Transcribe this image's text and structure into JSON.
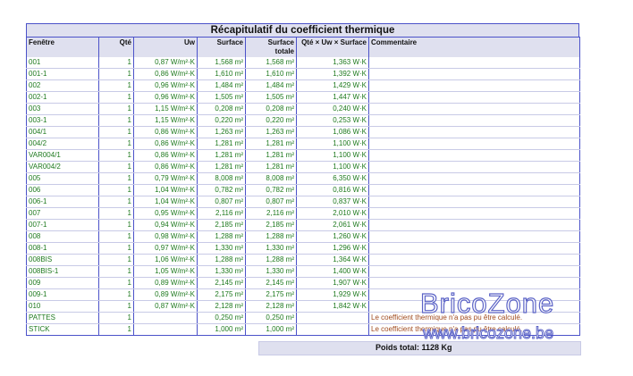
{
  "title": "Récapitulatif du coefficient thermique",
  "columns": [
    "Fenêtre",
    "Qté",
    "Uw",
    "Surface",
    "Surface totale",
    "Qté × Uw × Surface",
    "Commentaire"
  ],
  "rows": [
    [
      "001",
      "1",
      "0,87 W/m²·K",
      "1,568 m²",
      "1,568 m²",
      "1,363 W·K",
      ""
    ],
    [
      "001-1",
      "1",
      "0,86 W/m²·K",
      "1,610 m²",
      "1,610 m²",
      "1,392 W·K",
      ""
    ],
    [
      "002",
      "1",
      "0,96 W/m²·K",
      "1,484 m²",
      "1,484 m²",
      "1,429 W·K",
      ""
    ],
    [
      "002-1",
      "1",
      "0,96 W/m²·K",
      "1,505 m²",
      "1,505 m²",
      "1,447 W·K",
      ""
    ],
    [
      "003",
      "1",
      "1,15 W/m²·K",
      "0,208 m²",
      "0,208 m²",
      "0,240 W·K",
      ""
    ],
    [
      "003-1",
      "1",
      "1,15 W/m²·K",
      "0,220 m²",
      "0,220 m²",
      "0,253 W·K",
      ""
    ],
    [
      "004/1",
      "1",
      "0,86 W/m²·K",
      "1,263 m²",
      "1,263 m²",
      "1,086 W·K",
      ""
    ],
    [
      "004/2",
      "1",
      "0,86 W/m²·K",
      "1,281 m²",
      "1,281 m²",
      "1,100 W·K",
      ""
    ],
    [
      "VAR004/1",
      "1",
      "0,86 W/m²·K",
      "1,281 m²",
      "1,281 m²",
      "1,100 W·K",
      ""
    ],
    [
      "VAR004/2",
      "1",
      "0,86 W/m²·K",
      "1,281 m²",
      "1,281 m²",
      "1,100 W·K",
      ""
    ],
    [
      "005",
      "1",
      "0,79 W/m²·K",
      "8,008 m²",
      "8,008 m²",
      "6,350 W·K",
      ""
    ],
    [
      "006",
      "1",
      "1,04 W/m²·K",
      "0,782 m²",
      "0,782 m²",
      "0,816 W·K",
      ""
    ],
    [
      "006-1",
      "1",
      "1,04 W/m²·K",
      "0,807 m²",
      "0,807 m²",
      "0,837 W·K",
      ""
    ],
    [
      "007",
      "1",
      "0,95 W/m²·K",
      "2,116 m²",
      "2,116 m²",
      "2,010 W·K",
      ""
    ],
    [
      "007-1",
      "1",
      "0,94 W/m²·K",
      "2,185 m²",
      "2,185 m²",
      "2,061 W·K",
      ""
    ],
    [
      "008",
      "1",
      "0,98 W/m²·K",
      "1,288 m²",
      "1,288 m²",
      "1,260 W·K",
      ""
    ],
    [
      "008-1",
      "1",
      "0,97 W/m²·K",
      "1,330 m²",
      "1,330 m²",
      "1,296 W·K",
      ""
    ],
    [
      "008BIS",
      "1",
      "1,06 W/m²·K",
      "1,288 m²",
      "1,288 m²",
      "1,364 W·K",
      ""
    ],
    [
      "008BIS-1",
      "1",
      "1,05 W/m²·K",
      "1,330 m²",
      "1,330 m²",
      "1,400 W·K",
      ""
    ],
    [
      "009",
      "1",
      "0,89 W/m²·K",
      "2,145 m²",
      "2,145 m²",
      "1,907 W·K",
      ""
    ],
    [
      "009-1",
      "1",
      "0,89 W/m²·K",
      "2,175 m²",
      "2,175 m²",
      "1,929 W·K",
      ""
    ],
    [
      "010",
      "1",
      "0,87 W/m²·K",
      "2,128 m²",
      "2,128 m²",
      "1,842 W·K",
      ""
    ],
    [
      "PATTES",
      "1",
      "",
      "0,250 m²",
      "0,250 m²",
      "",
      "Le coefficient thermique n'a pas pu être calculé."
    ],
    [
      "STICK",
      "1",
      "",
      "1,000 m²",
      "1,000 m²",
      "",
      "Le coefficient thermique n'a pas pu être calculé."
    ]
  ],
  "total": "Poids total: 1128 Kg",
  "watermark": {
    "brand": "BricoZone",
    "url": "www.bricozone.be"
  }
}
